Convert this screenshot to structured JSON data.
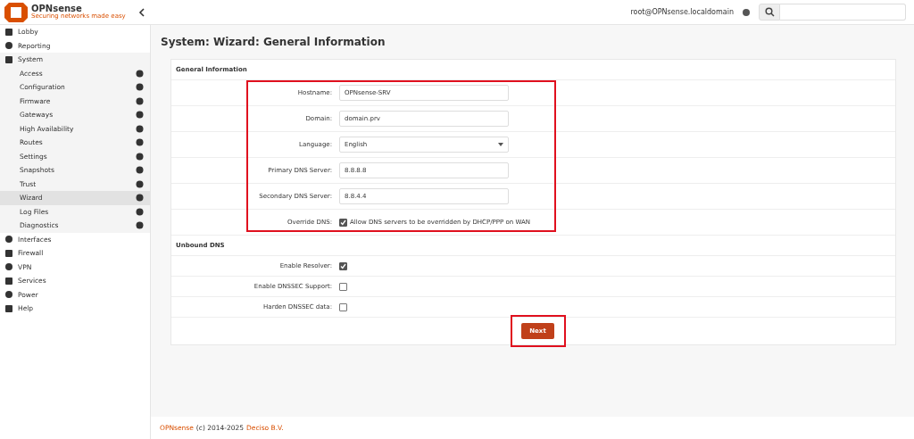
{
  "header": {
    "logo_name": "OPNsense",
    "logo_tagline": "Securing networks made easy",
    "user": "root@OPNsense.localdomain"
  },
  "sidebar": {
    "items": [
      {
        "label": "Lobby"
      },
      {
        "label": "Reporting"
      },
      {
        "label": "System",
        "children": [
          {
            "label": "Access",
            "selected": false
          },
          {
            "label": "Configuration",
            "selected": false
          },
          {
            "label": "Firmware",
            "selected": false
          },
          {
            "label": "Gateways",
            "selected": false
          },
          {
            "label": "High Availability",
            "selected": false
          },
          {
            "label": "Routes",
            "selected": false
          },
          {
            "label": "Settings",
            "selected": false
          },
          {
            "label": "Snapshots",
            "selected": false
          },
          {
            "label": "Trust",
            "selected": false
          },
          {
            "label": "Wizard",
            "selected": true
          },
          {
            "label": "Log Files",
            "selected": false
          },
          {
            "label": "Diagnostics",
            "selected": false
          }
        ]
      },
      {
        "label": "Interfaces"
      },
      {
        "label": "Firewall"
      },
      {
        "label": "VPN"
      },
      {
        "label": "Services"
      },
      {
        "label": "Power"
      },
      {
        "label": "Help"
      }
    ]
  },
  "page_title": "System: Wizard: General Information",
  "sections": [
    {
      "title": "General Information",
      "highlighted": true,
      "rows": [
        {
          "kind": "text",
          "label": "Hostname:",
          "value": "OPNsense-SRV"
        },
        {
          "kind": "text",
          "label": "Domain:",
          "value": "domain.prv"
        },
        {
          "kind": "select",
          "label": "Language:",
          "value": "English"
        },
        {
          "kind": "text",
          "label": "Primary DNS Server:",
          "value": "8.8.8.8"
        },
        {
          "kind": "text",
          "label": "Secondary DNS Server:",
          "value": "8.8.4.4"
        },
        {
          "kind": "checkbox",
          "label": "Override DNS:",
          "checked": true,
          "text": "Allow DNS servers to be overridden by DHCP/PPP on WAN"
        }
      ]
    },
    {
      "title": "Unbound DNS",
      "highlighted": false,
      "rows": [
        {
          "kind": "checkbox",
          "label": "Enable Resolver:",
          "checked": true
        },
        {
          "kind": "checkbox",
          "label": "Enable DNSSEC Support:",
          "checked": false
        },
        {
          "kind": "checkbox",
          "label": "Harden DNSSEC data:",
          "checked": false
        }
      ]
    }
  ],
  "next_button": {
    "label": "Next",
    "highlighted": true
  },
  "footer": {
    "product": "OPNsense",
    "text": "(c) 2014-2025",
    "company": "Deciso B.V."
  }
}
